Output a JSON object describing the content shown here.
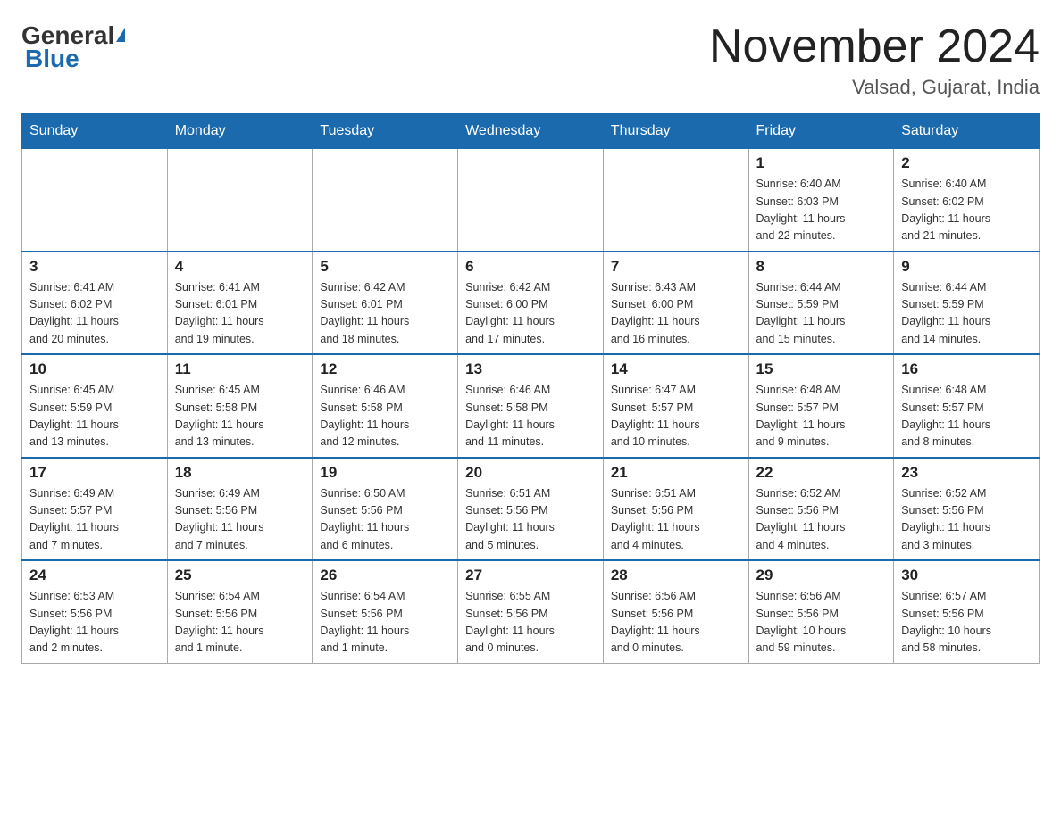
{
  "header": {
    "logo_general": "General",
    "logo_blue": "Blue",
    "month_year": "November 2024",
    "location": "Valsad, Gujarat, India"
  },
  "weekdays": [
    "Sunday",
    "Monday",
    "Tuesday",
    "Wednesday",
    "Thursday",
    "Friday",
    "Saturday"
  ],
  "weeks": [
    [
      {
        "day": "",
        "info": ""
      },
      {
        "day": "",
        "info": ""
      },
      {
        "day": "",
        "info": ""
      },
      {
        "day": "",
        "info": ""
      },
      {
        "day": "",
        "info": ""
      },
      {
        "day": "1",
        "info": "Sunrise: 6:40 AM\nSunset: 6:03 PM\nDaylight: 11 hours\nand 22 minutes."
      },
      {
        "day": "2",
        "info": "Sunrise: 6:40 AM\nSunset: 6:02 PM\nDaylight: 11 hours\nand 21 minutes."
      }
    ],
    [
      {
        "day": "3",
        "info": "Sunrise: 6:41 AM\nSunset: 6:02 PM\nDaylight: 11 hours\nand 20 minutes."
      },
      {
        "day": "4",
        "info": "Sunrise: 6:41 AM\nSunset: 6:01 PM\nDaylight: 11 hours\nand 19 minutes."
      },
      {
        "day": "5",
        "info": "Sunrise: 6:42 AM\nSunset: 6:01 PM\nDaylight: 11 hours\nand 18 minutes."
      },
      {
        "day": "6",
        "info": "Sunrise: 6:42 AM\nSunset: 6:00 PM\nDaylight: 11 hours\nand 17 minutes."
      },
      {
        "day": "7",
        "info": "Sunrise: 6:43 AM\nSunset: 6:00 PM\nDaylight: 11 hours\nand 16 minutes."
      },
      {
        "day": "8",
        "info": "Sunrise: 6:44 AM\nSunset: 5:59 PM\nDaylight: 11 hours\nand 15 minutes."
      },
      {
        "day": "9",
        "info": "Sunrise: 6:44 AM\nSunset: 5:59 PM\nDaylight: 11 hours\nand 14 minutes."
      }
    ],
    [
      {
        "day": "10",
        "info": "Sunrise: 6:45 AM\nSunset: 5:59 PM\nDaylight: 11 hours\nand 13 minutes."
      },
      {
        "day": "11",
        "info": "Sunrise: 6:45 AM\nSunset: 5:58 PM\nDaylight: 11 hours\nand 13 minutes."
      },
      {
        "day": "12",
        "info": "Sunrise: 6:46 AM\nSunset: 5:58 PM\nDaylight: 11 hours\nand 12 minutes."
      },
      {
        "day": "13",
        "info": "Sunrise: 6:46 AM\nSunset: 5:58 PM\nDaylight: 11 hours\nand 11 minutes."
      },
      {
        "day": "14",
        "info": "Sunrise: 6:47 AM\nSunset: 5:57 PM\nDaylight: 11 hours\nand 10 minutes."
      },
      {
        "day": "15",
        "info": "Sunrise: 6:48 AM\nSunset: 5:57 PM\nDaylight: 11 hours\nand 9 minutes."
      },
      {
        "day": "16",
        "info": "Sunrise: 6:48 AM\nSunset: 5:57 PM\nDaylight: 11 hours\nand 8 minutes."
      }
    ],
    [
      {
        "day": "17",
        "info": "Sunrise: 6:49 AM\nSunset: 5:57 PM\nDaylight: 11 hours\nand 7 minutes."
      },
      {
        "day": "18",
        "info": "Sunrise: 6:49 AM\nSunset: 5:56 PM\nDaylight: 11 hours\nand 7 minutes."
      },
      {
        "day": "19",
        "info": "Sunrise: 6:50 AM\nSunset: 5:56 PM\nDaylight: 11 hours\nand 6 minutes."
      },
      {
        "day": "20",
        "info": "Sunrise: 6:51 AM\nSunset: 5:56 PM\nDaylight: 11 hours\nand 5 minutes."
      },
      {
        "day": "21",
        "info": "Sunrise: 6:51 AM\nSunset: 5:56 PM\nDaylight: 11 hours\nand 4 minutes."
      },
      {
        "day": "22",
        "info": "Sunrise: 6:52 AM\nSunset: 5:56 PM\nDaylight: 11 hours\nand 4 minutes."
      },
      {
        "day": "23",
        "info": "Sunrise: 6:52 AM\nSunset: 5:56 PM\nDaylight: 11 hours\nand 3 minutes."
      }
    ],
    [
      {
        "day": "24",
        "info": "Sunrise: 6:53 AM\nSunset: 5:56 PM\nDaylight: 11 hours\nand 2 minutes."
      },
      {
        "day": "25",
        "info": "Sunrise: 6:54 AM\nSunset: 5:56 PM\nDaylight: 11 hours\nand 1 minute."
      },
      {
        "day": "26",
        "info": "Sunrise: 6:54 AM\nSunset: 5:56 PM\nDaylight: 11 hours\nand 1 minute."
      },
      {
        "day": "27",
        "info": "Sunrise: 6:55 AM\nSunset: 5:56 PM\nDaylight: 11 hours\nand 0 minutes."
      },
      {
        "day": "28",
        "info": "Sunrise: 6:56 AM\nSunset: 5:56 PM\nDaylight: 11 hours\nand 0 minutes."
      },
      {
        "day": "29",
        "info": "Sunrise: 6:56 AM\nSunset: 5:56 PM\nDaylight: 10 hours\nand 59 minutes."
      },
      {
        "day": "30",
        "info": "Sunrise: 6:57 AM\nSunset: 5:56 PM\nDaylight: 10 hours\nand 58 minutes."
      }
    ]
  ]
}
